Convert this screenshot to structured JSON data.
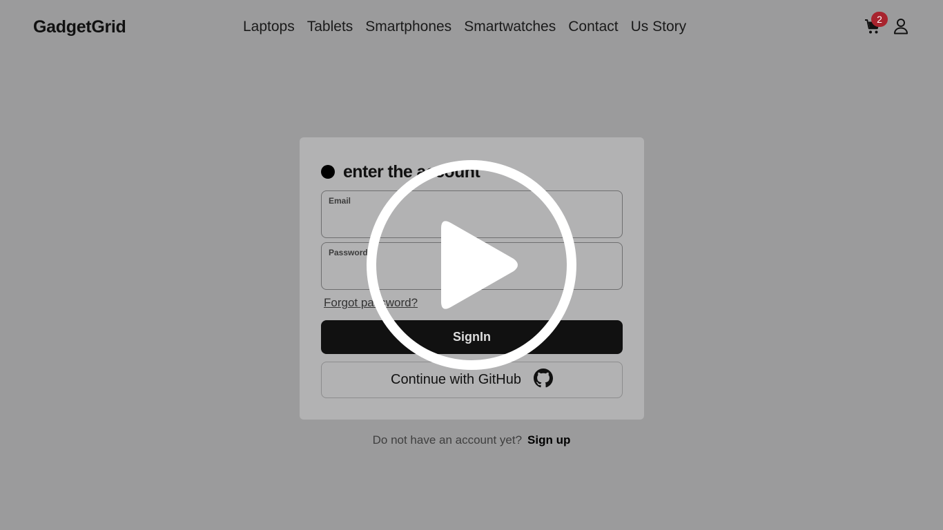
{
  "brand": "GadgetGrid",
  "nav": {
    "items": [
      "Laptops",
      "Tablets",
      "Smartphones",
      "Smartwatches",
      "Contact",
      "Us Story"
    ]
  },
  "cart": {
    "count": "2",
    "icon": "cart-icon"
  },
  "user_icon": "user-icon",
  "signin_form": {
    "title": "enter the account",
    "email_label": "Email",
    "email_value": "",
    "password_label": "Password",
    "password_value": "",
    "forgot_link": "Forgot password?",
    "submit_label": "SignIn",
    "github_label": "Continue with GitHub",
    "github_icon": "github-icon"
  },
  "signup": {
    "prompt": "Do not have an account yet?",
    "link": "Sign up"
  },
  "overlay": {
    "icon": "play-icon"
  },
  "colors": {
    "page_bg": "#9b9b9c",
    "card_bg": "#b2b2b3",
    "badge": "#a8242e",
    "button_dark": "#111111"
  }
}
